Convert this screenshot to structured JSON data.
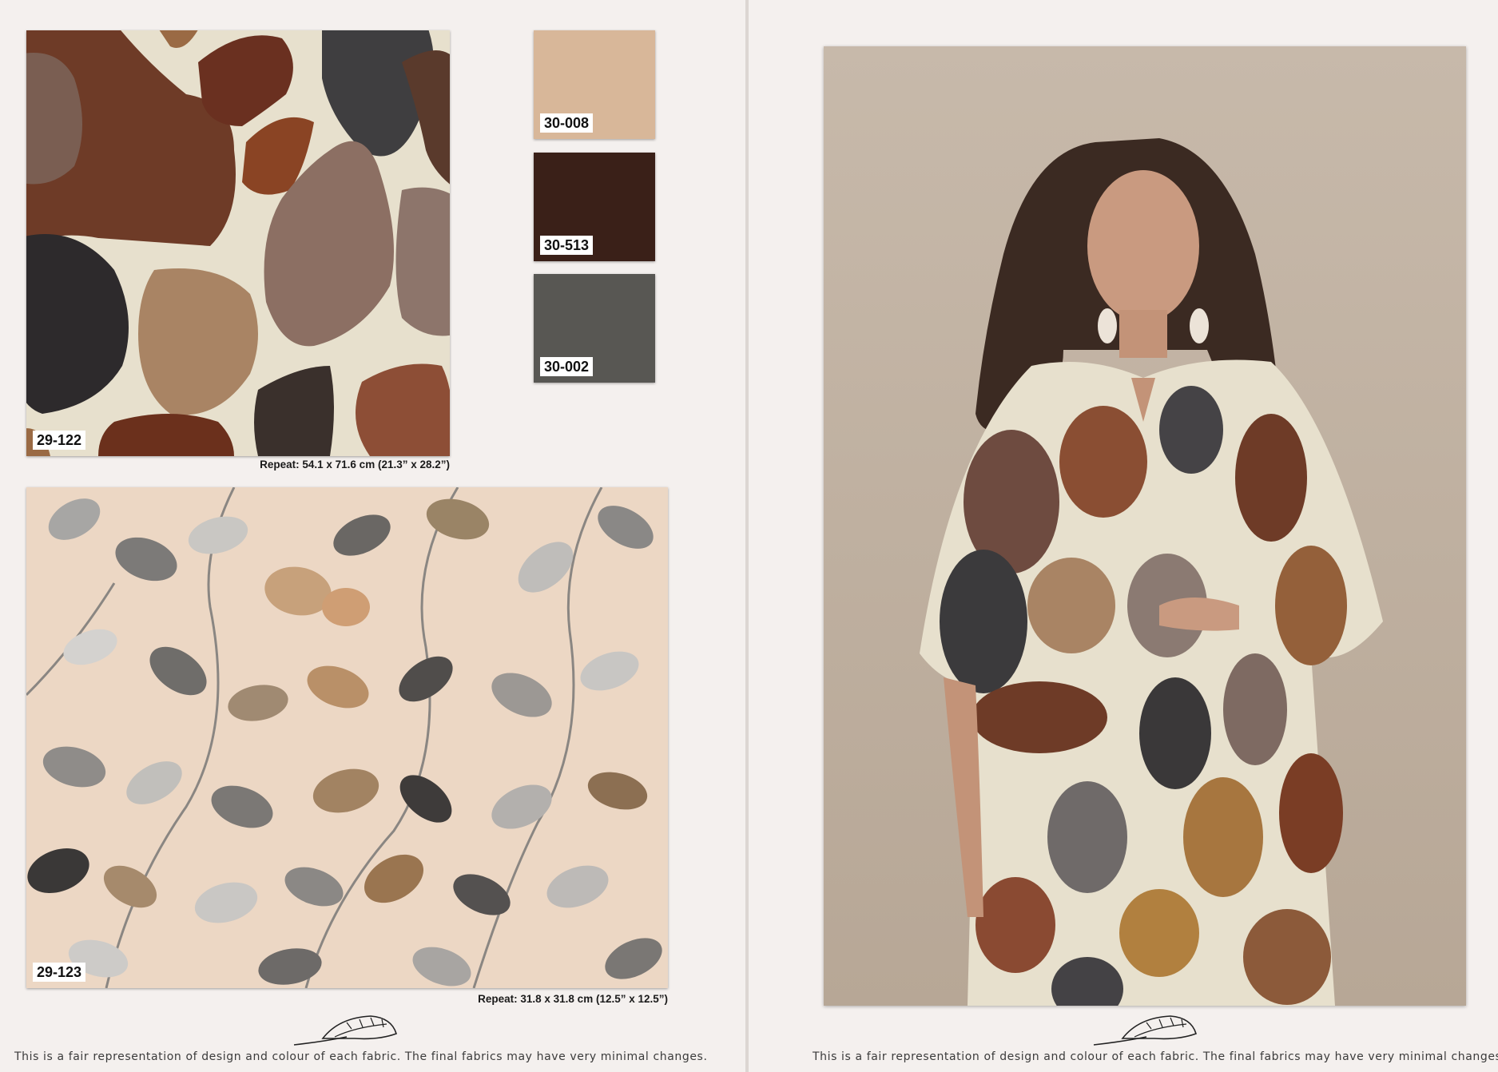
{
  "left_page": {
    "print_1": {
      "code": "29-122",
      "repeat": "Repeat: 54.1 x 71.6 cm (21.3” x 28.2”)"
    },
    "print_2": {
      "code": "29-123",
      "repeat": "Repeat: 31.8 x 31.8 cm (12.5” x 12.5”)"
    },
    "solids": [
      {
        "code": "30-008",
        "color": "#d8b799"
      },
      {
        "code": "30-513",
        "color": "#3a2018"
      },
      {
        "code": "30-002",
        "color": "#585753"
      }
    ],
    "disclaimer": "This is a fair representation of design and colour of each fabric. The final fabrics may have very minimal changes."
  },
  "right_page": {
    "disclaimer": "This is a fair representation of design and colour of each fabric. The final fabrics may have very minimal changes."
  },
  "colors": {
    "page_bg": "#f4f0ee",
    "print_1_ground": "#e7e0cd",
    "print_2_ground": "#ecd7c4",
    "photo_bg": "#c2b3a3"
  }
}
